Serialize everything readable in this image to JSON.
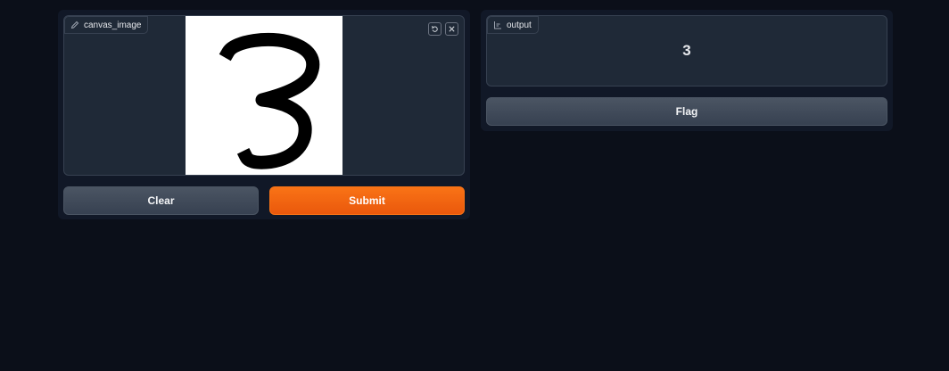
{
  "input": {
    "label": "canvas_image",
    "label_icon": "pencil-icon",
    "tools": [
      "undo-icon",
      "close-icon"
    ]
  },
  "buttons": {
    "clear": "Clear",
    "submit": "Submit",
    "flag": "Flag"
  },
  "output": {
    "label": "output",
    "label_icon": "label-icon",
    "value": "3"
  },
  "colors": {
    "background": "#0b0f19",
    "panel": "#111827",
    "block": "#1f2937",
    "border": "#374151",
    "primary": "#f97316",
    "secondary": "#4b5563"
  }
}
